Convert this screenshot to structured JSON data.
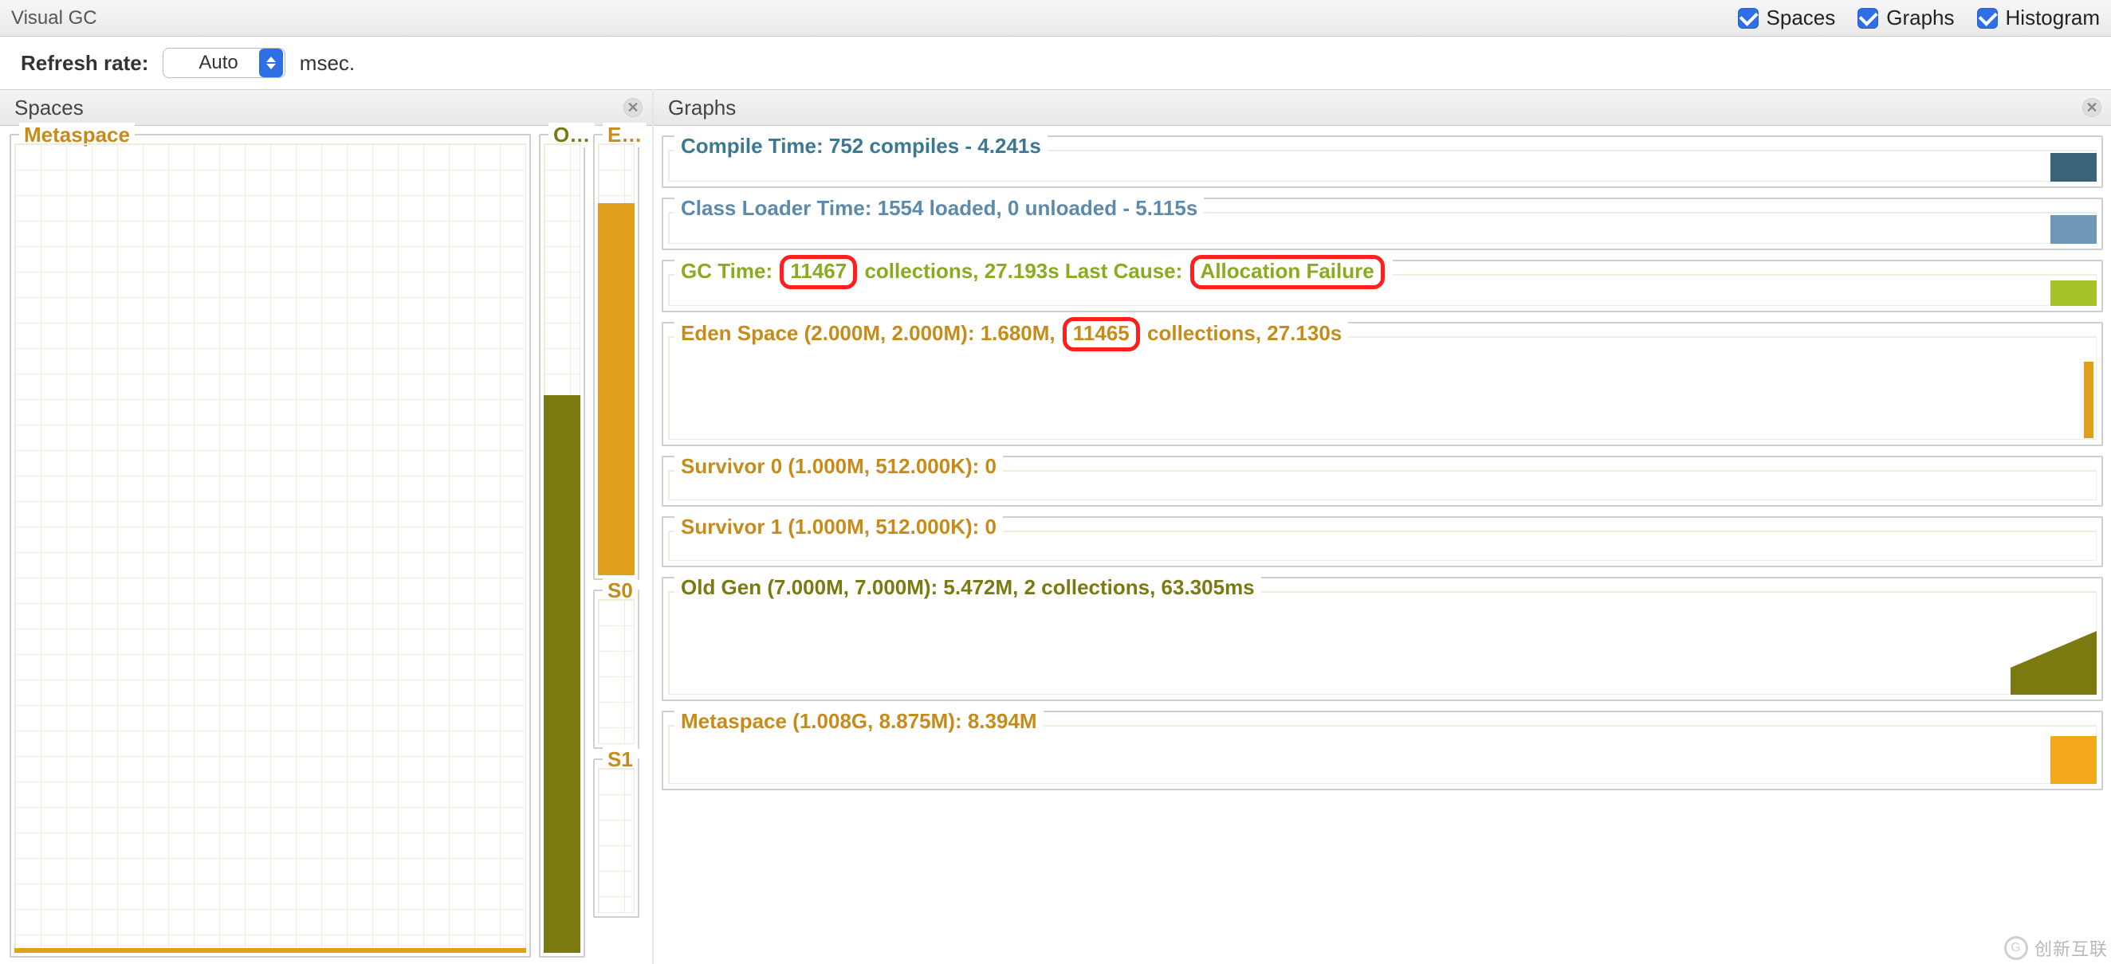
{
  "header": {
    "title": "Visual GC",
    "toggles": {
      "spaces": "Spaces",
      "graphs": "Graphs",
      "histogram": "Histogram"
    }
  },
  "refresh": {
    "label": "Refresh rate:",
    "select_value": "Auto",
    "unit": "msec."
  },
  "sections": {
    "spaces_caption": "Spaces",
    "graphs_caption": "Graphs"
  },
  "spaces": {
    "metaspace": {
      "label": "Metaspace",
      "fill_pct": 1
    },
    "old": {
      "label": "O…",
      "fill_pct": 68
    },
    "eden": {
      "label": "E…",
      "fill_pct": 84
    },
    "s0": {
      "label": "S0",
      "fill_pct": 0
    },
    "s1": {
      "label": "S1",
      "fill_pct": 0
    }
  },
  "graphs": {
    "compile": {
      "prefix": "Compile Time: ",
      "body": "752 compiles - 4.241s"
    },
    "classloader": {
      "prefix": "Class Loader Time: ",
      "body": "1554 loaded, 0 unloaded - 5.115s"
    },
    "gc": {
      "prefix": "GC Time:",
      "count": "11467",
      "mid1": "collections, 27.193s  Last Cause:",
      "cause": "Allocation Failure"
    },
    "eden": {
      "prefix": "Eden Space (2.000M, 2.000M): 1.680M,",
      "count": "11465",
      "suffix": "collections, 27.130s"
    },
    "s0": {
      "text": "Survivor 0 (1.000M, 512.000K): 0"
    },
    "s1": {
      "text": "Survivor 1 (1.000M, 512.000K): 0"
    },
    "old": {
      "text": "Old Gen (7.000M, 7.000M): 5.472M, 2 collections, 63.305ms"
    },
    "meta": {
      "text": "Metaspace (1.008G, 8.875M): 8.394M"
    }
  },
  "watermark": "创新互联"
}
